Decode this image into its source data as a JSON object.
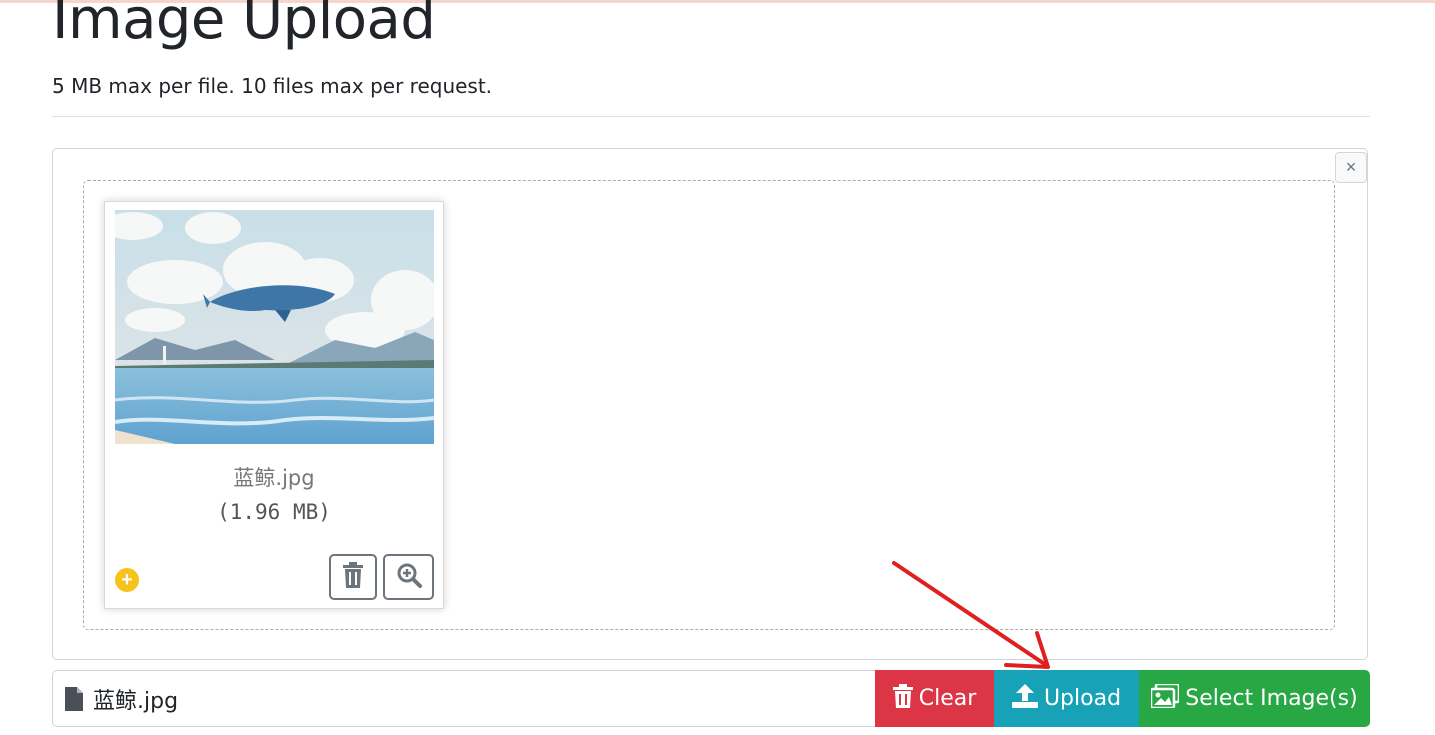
{
  "page": {
    "title": "Image Upload",
    "subtitle": "5 MB max per file. 10 files max per request."
  },
  "preview": {
    "close_symbol": "×",
    "file": {
      "name": "蓝鲸.jpg",
      "size": "(1.96 MB)",
      "status_symbol": "+"
    },
    "icons": {
      "remove": "trash-icon",
      "zoom": "zoom-in-icon",
      "status": "plus-circle-icon"
    }
  },
  "caption": {
    "icon": "file-icon",
    "filename": "蓝鲸.jpg"
  },
  "actions": {
    "clear_label": "Clear",
    "upload_label": "Upload",
    "select_label": "Select Image(s)"
  },
  "colors": {
    "clear": "#dc3545",
    "upload": "#17a2b8",
    "select": "#28a745",
    "annotation_arrow": "#e0201f"
  }
}
